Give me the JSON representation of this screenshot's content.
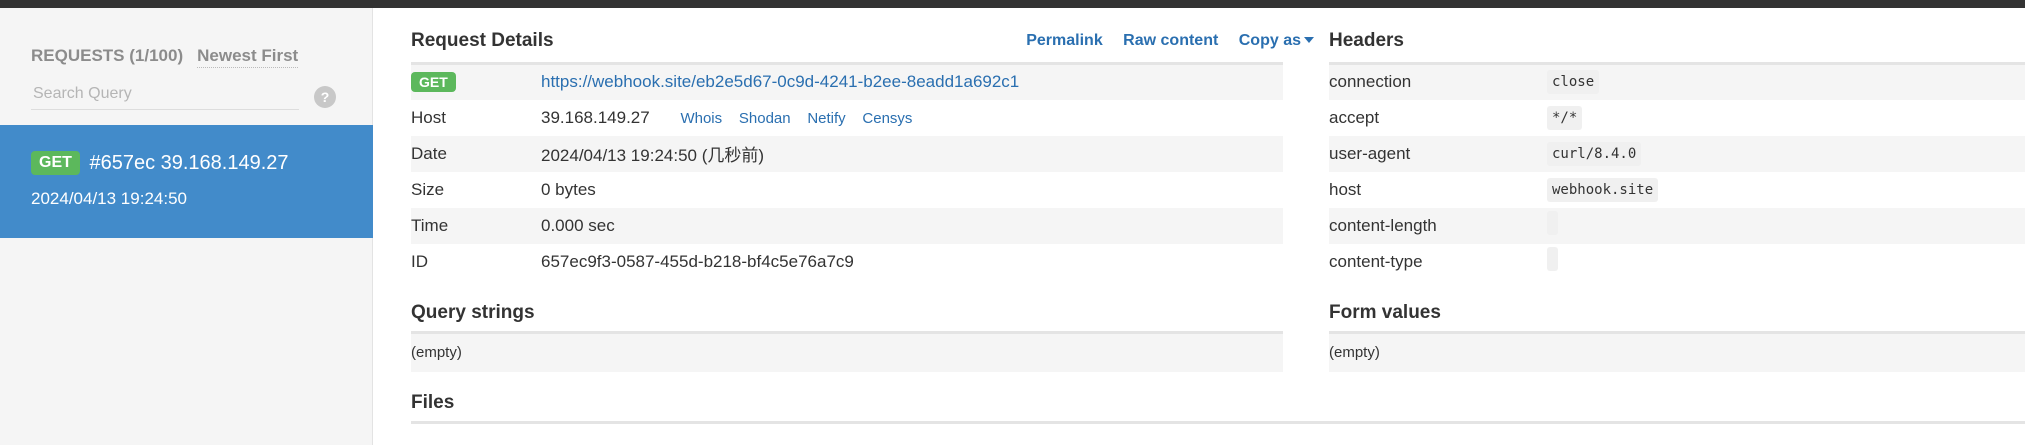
{
  "sidebar": {
    "requests_label": "REQUESTS (1/100)",
    "sort_label": "Newest First",
    "search_placeholder": "Search Query",
    "help_symbol": "?",
    "selected_request": {
      "method": "GET",
      "id_ip": "#657ec 39.168.149.27",
      "timestamp": "2024/04/13 19:24:50"
    }
  },
  "request_details": {
    "title": "Request Details",
    "actions": {
      "permalink": "Permalink",
      "raw_content": "Raw content",
      "copy_as": "Copy as"
    },
    "method": "GET",
    "url": "https://webhook.site/eb2e5d67-0c9d-4241-b2ee-8eadd1a692c1",
    "rows": {
      "host_key": "Host",
      "host_value": "39.168.149.27",
      "host_tools": [
        "Whois",
        "Shodan",
        "Netify",
        "Censys"
      ],
      "date_key": "Date",
      "date_value": "2024/04/13 19:24:50 (几秒前)",
      "size_key": "Size",
      "size_value": "0 bytes",
      "time_key": "Time",
      "time_value": "0.000 sec",
      "id_key": "ID",
      "id_value": "657ec9f3-0587-455d-b218-bf4c5e76a7c9"
    }
  },
  "headers": {
    "title": "Headers",
    "items": [
      {
        "key": "connection",
        "value": "close"
      },
      {
        "key": "accept",
        "value": "*/*"
      },
      {
        "key": "user-agent",
        "value": "curl/8.4.0"
      },
      {
        "key": "host",
        "value": "webhook.site"
      },
      {
        "key": "content-length",
        "value": ""
      },
      {
        "key": "content-type",
        "value": ""
      }
    ]
  },
  "query_strings": {
    "title": "Query strings",
    "empty": "(empty)"
  },
  "form_values": {
    "title": "Form values",
    "empty": "(empty)"
  },
  "files": {
    "title": "Files"
  },
  "colors": {
    "accent_blue": "#428bca",
    "link_blue": "#2a6fb0",
    "get_green": "#5cb85c",
    "topbar": "#333333",
    "sidebar_bg": "#f5f5f5"
  }
}
